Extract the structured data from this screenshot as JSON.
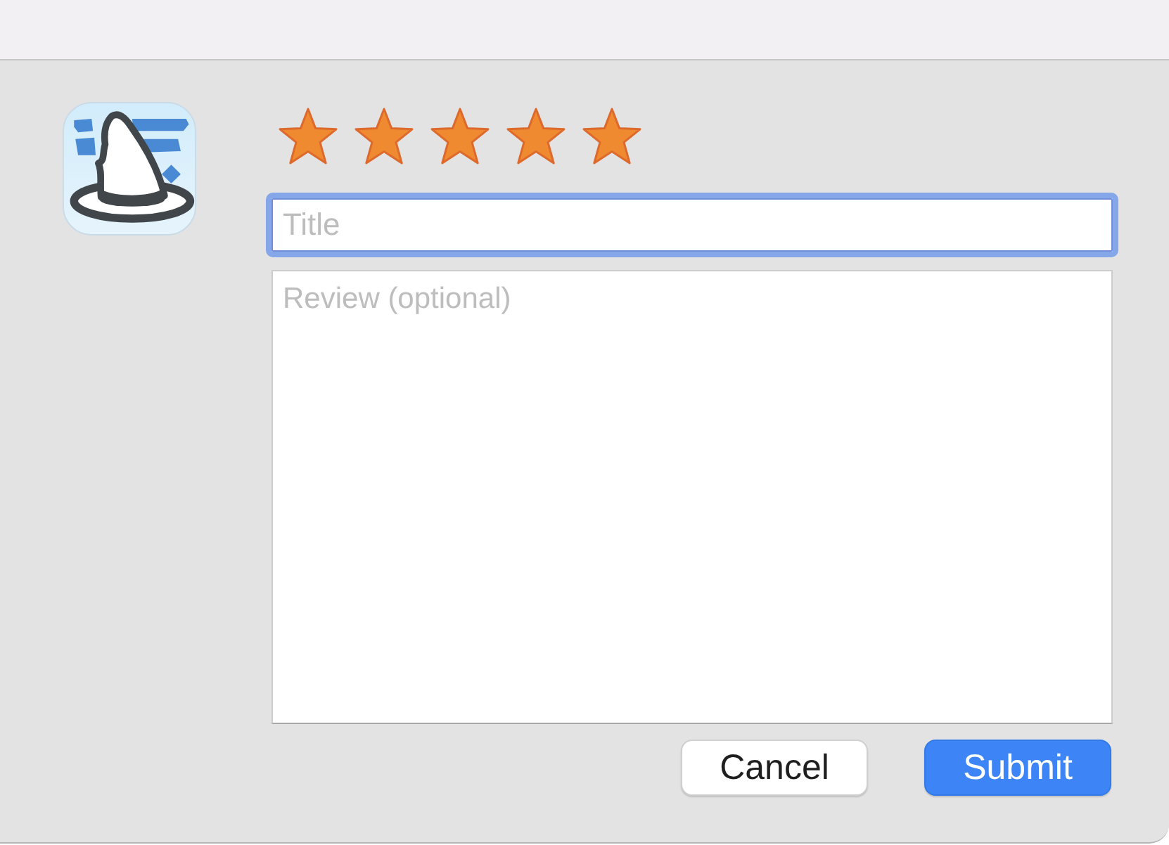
{
  "rating": {
    "stars": 5
  },
  "title_field": {
    "placeholder": "Title",
    "focused": true
  },
  "review_field": {
    "placeholder": "Review (optional)"
  },
  "buttons": [
    {
      "label": "Cancel",
      "kind": "secondary"
    },
    {
      "label": "Submit",
      "kind": "primary"
    }
  ]
}
